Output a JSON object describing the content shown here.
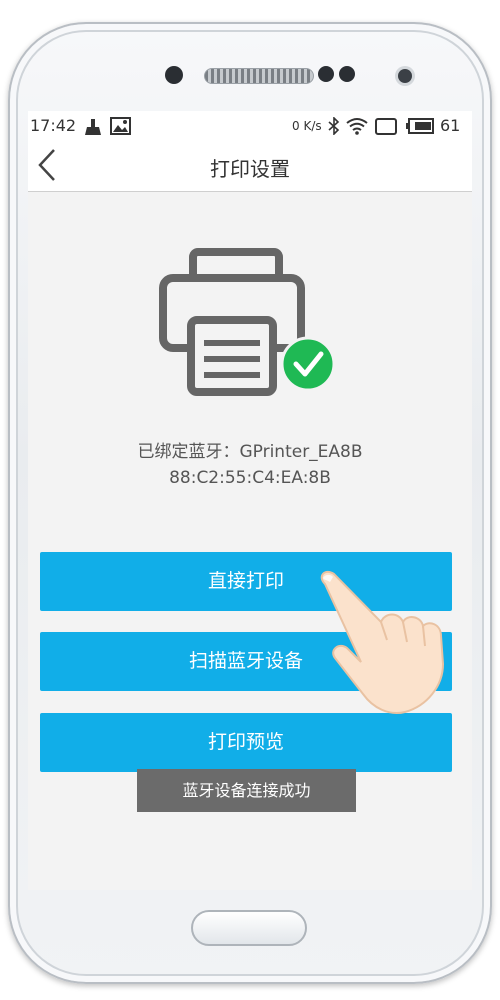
{
  "status_bar": {
    "time": "17:42",
    "speed": "0 K/s",
    "battery": "61",
    "icons": [
      "broom-icon",
      "image-icon",
      "bluetooth-icon",
      "wifi-icon",
      "screen-icon",
      "battery-icon"
    ]
  },
  "header": {
    "title": "打印设置",
    "back_icon": "back-arrow-icon"
  },
  "printer": {
    "icon": "printer-icon",
    "status_icon": "check-circle-icon",
    "bound_text": "已绑定蓝牙：GPrinter_EA8B",
    "mac_address": "88:C2:55:C4:EA:8B"
  },
  "buttons": {
    "direct_print": "直接打印",
    "scan_bluetooth": "扫描蓝牙设备",
    "print_preview": "打印预览"
  },
  "toast": {
    "message": "蓝牙设备连接成功"
  },
  "colors": {
    "accent": "#11aee8",
    "success": "#1fb954",
    "toast_bg": "#6b6b6b"
  }
}
